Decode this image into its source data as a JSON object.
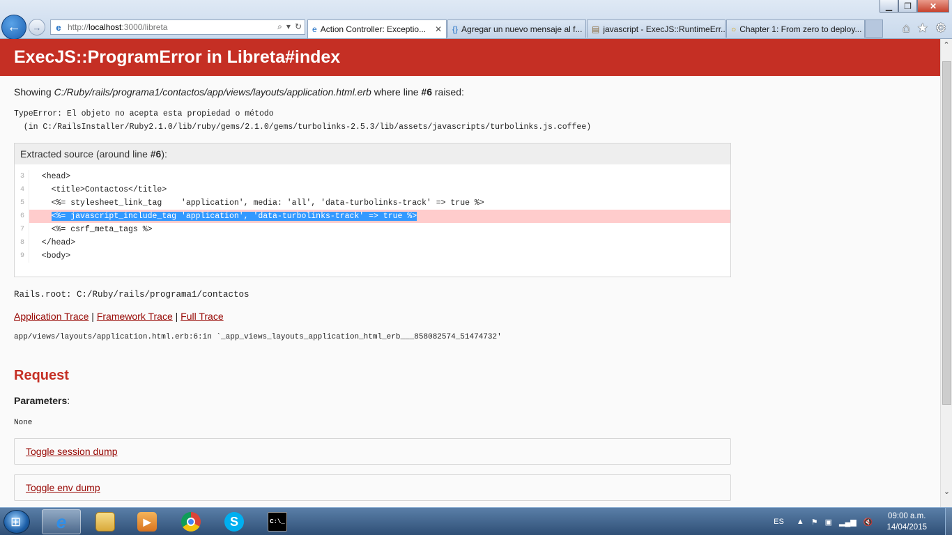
{
  "window": {
    "minimize_label": "▁",
    "maximize_label": "❐",
    "close_label": "✕"
  },
  "browser": {
    "back_label": "←",
    "forward_label": "→",
    "address_prefix": "http://",
    "address_host": "localhost",
    "address_rest": ":3000/libreta",
    "tabs": [
      {
        "label": "Action Controller: Exceptio...",
        "active": true,
        "icon": "ie-icon"
      },
      {
        "label": "Agregar un nuevo mensaje al f...",
        "active": false,
        "icon": "braces-icon"
      },
      {
        "label": "javascript - ExecJS::RuntimeErr...",
        "active": false,
        "icon": "page-icon"
      },
      {
        "label": "Chapter 1: From zero to deploy...",
        "active": false,
        "icon": "circle-icon"
      }
    ]
  },
  "page": {
    "title": "ExecJS::ProgramError in Libreta#index",
    "showing_prefix": "Showing ",
    "showing_file": "C:/Ruby/rails/programa1/contactos/app/views/layouts/application.html.erb",
    "showing_middle": " where line ",
    "showing_line": "#6",
    "showing_suffix": " raised:",
    "error_message": "TypeError: El objeto no acepta esta propiedad o método\n  (in C:/RailsInstaller/Ruby2.1.0/lib/ruby/gems/2.1.0/gems/turbolinks-2.5.3/lib/assets/javascripts/turbolinks.js.coffee)",
    "extracted_prefix": "Extracted source (around line ",
    "extracted_line": "#6",
    "extracted_suffix": "):",
    "source_lines": [
      {
        "num": "3",
        "code": "  <head>",
        "highlight": false
      },
      {
        "num": "4",
        "code": "    <title>Contactos</title>",
        "highlight": false
      },
      {
        "num": "5",
        "code": "    <%= stylesheet_link_tag    'application', media: 'all', 'data-turbolinks-track' => true %>",
        "highlight": false
      },
      {
        "num": "6",
        "code": "    <%= javascript_include_tag 'application', 'data-turbolinks-track' => true %>",
        "highlight": true
      },
      {
        "num": "7",
        "code": "    <%= csrf_meta_tags %>",
        "highlight": false
      },
      {
        "num": "8",
        "code": "  </head>",
        "highlight": false
      },
      {
        "num": "9",
        "code": "  <body>",
        "highlight": false
      }
    ],
    "rails_root": "Rails.root: C:/Ruby/rails/programa1/contactos",
    "trace_links": [
      "Application Trace",
      "Framework Trace",
      "Full Trace"
    ],
    "trace_separator": " | ",
    "trace_line": "app/views/layouts/application.html.erb:6:in `_app_views_layouts_application_html_erb___858082574_51474732'",
    "request_heading": "Request",
    "parameters_label": "Parameters",
    "parameters_colon": ":",
    "parameters_value": "None",
    "toggle_session": "Toggle session dump",
    "toggle_env": "Toggle env dump"
  },
  "taskbar": {
    "apps": [
      {
        "name": "internet-explorer",
        "active": true
      },
      {
        "name": "file-explorer",
        "active": false
      },
      {
        "name": "media-player",
        "active": false
      },
      {
        "name": "chrome",
        "active": false
      },
      {
        "name": "skype",
        "active": false
      },
      {
        "name": "command-prompt",
        "active": false
      }
    ],
    "language": "ES",
    "time": "09:00 a.m.",
    "date": "14/04/2015"
  },
  "colors": {
    "header_bg": "#c52f24",
    "link": "#980905",
    "highlight_row": "#ffcccc",
    "selection": "#3399ff"
  }
}
